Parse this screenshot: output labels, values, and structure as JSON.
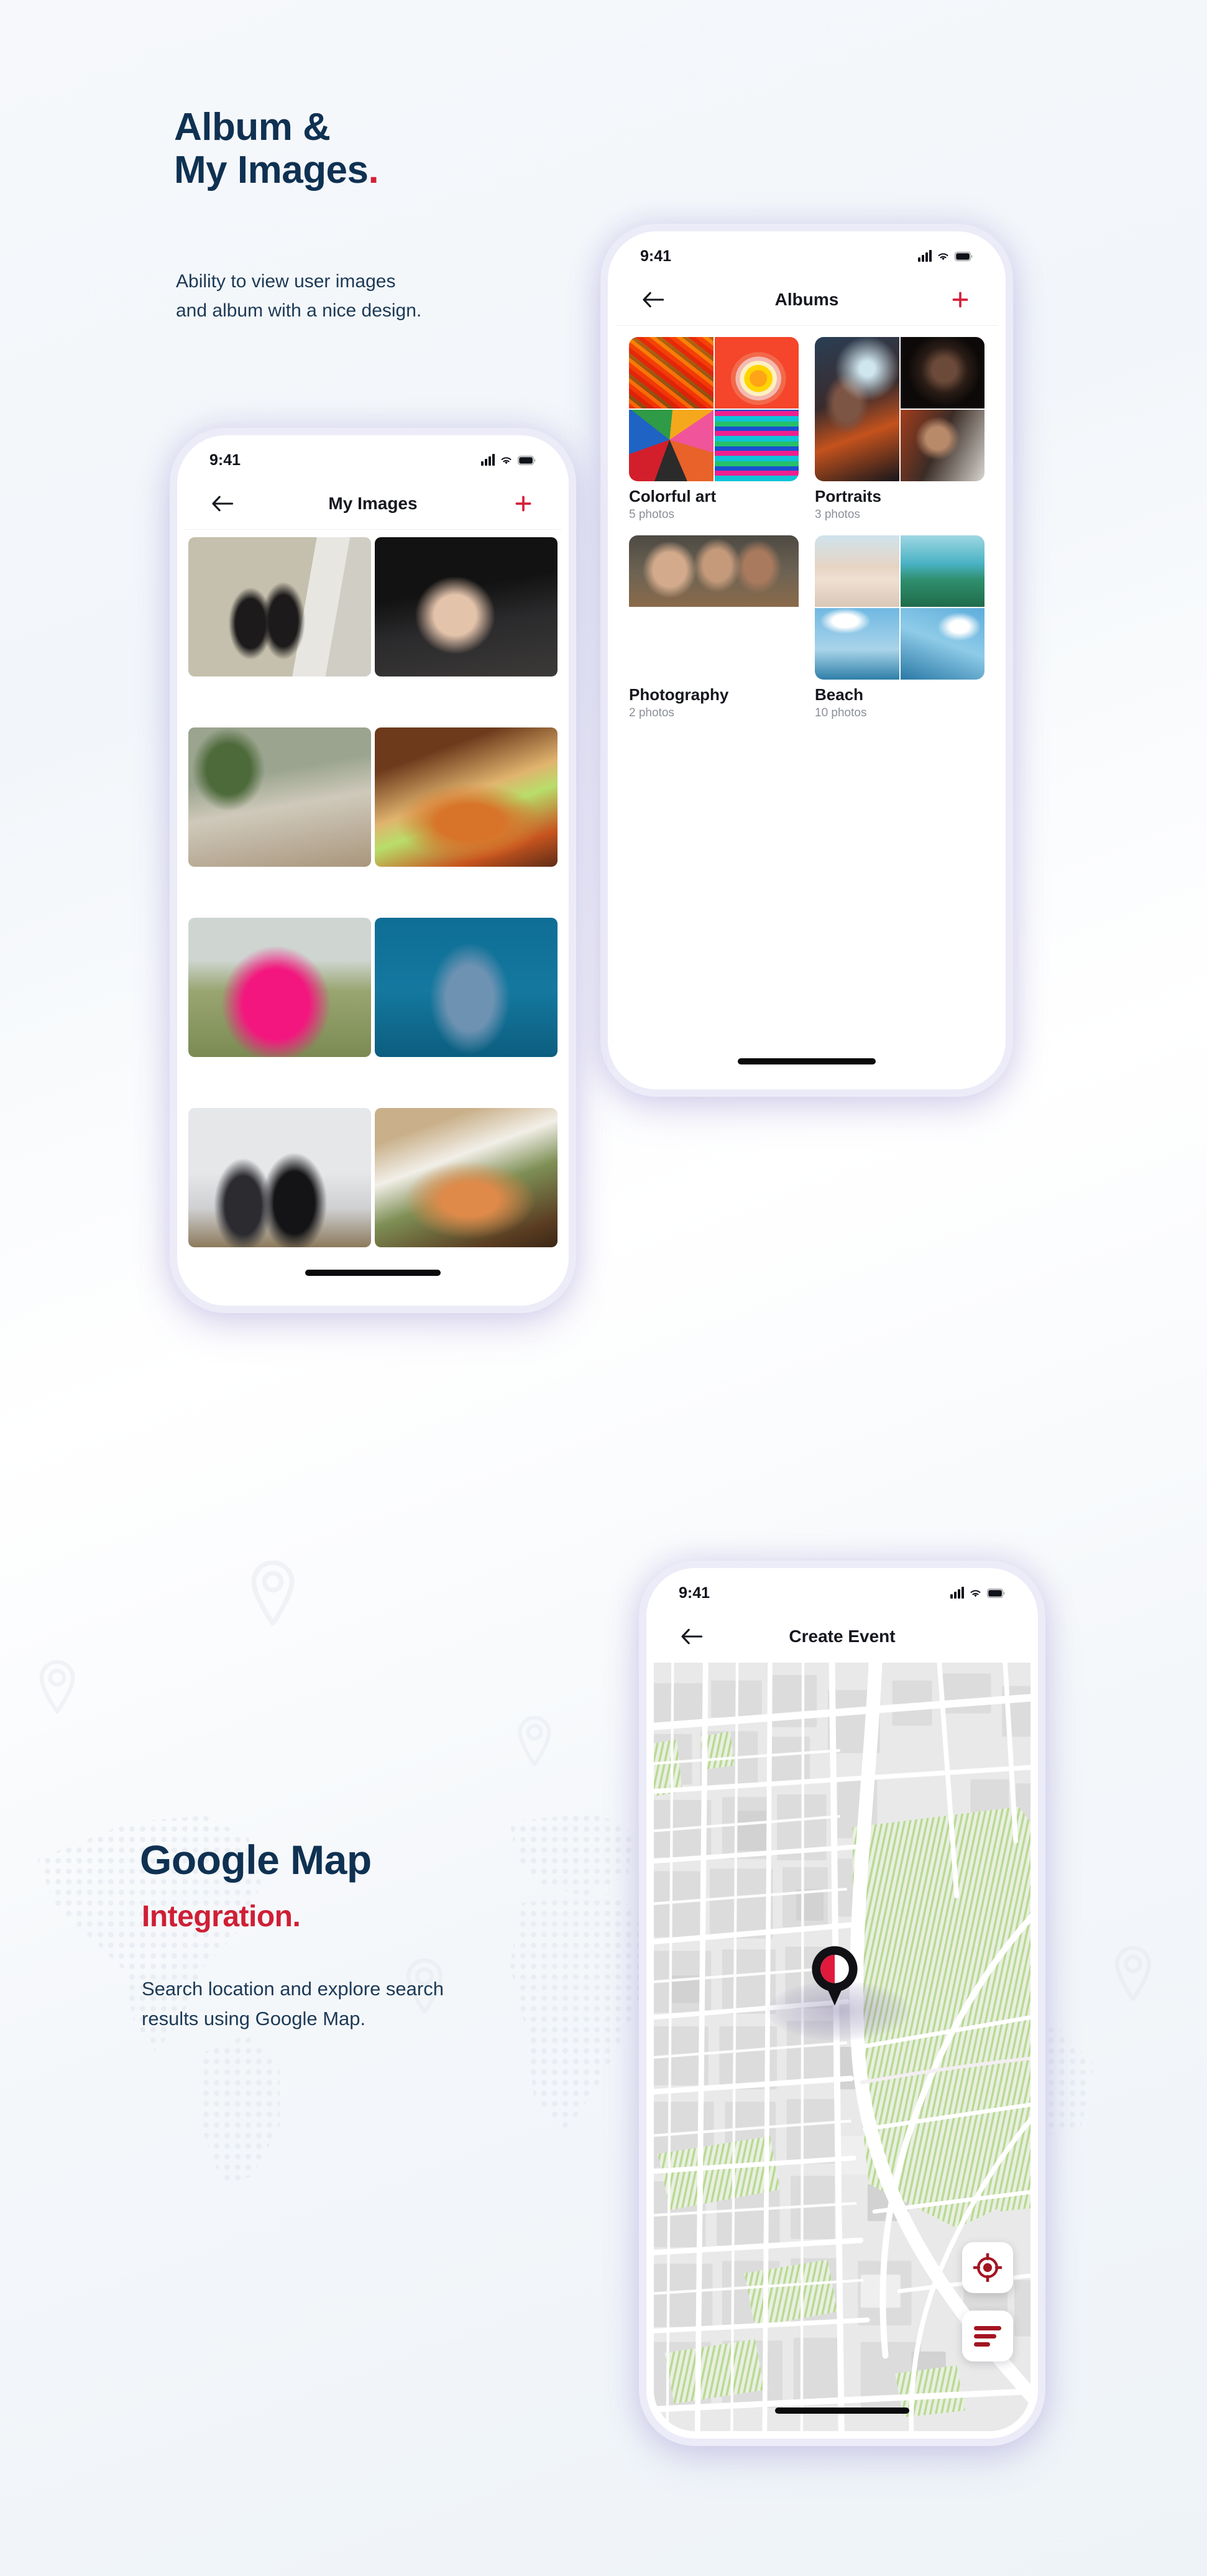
{
  "section1": {
    "headline_line1": "Album &",
    "headline_line2": "My Images",
    "headline_dot": ".",
    "sub_line1": "Ability to view user images",
    "sub_line2": "and album with a nice design."
  },
  "section2": {
    "headline": "Google Map",
    "headline_sub": "Integration",
    "headline_dot": ".",
    "sub_line1": "Search location and explore search",
    "sub_line2": "results using Google Map."
  },
  "colors": {
    "navy": "#0f3152",
    "red": "#d32038",
    "accent_dark_red": "#a31521",
    "bezel": "#ecebf8",
    "page_bg": "#f4f7fa"
  },
  "phone_my_images": {
    "status": {
      "time": "9:41",
      "signal_icon": "cellular-bars-icon",
      "wifi_icon": "wifi-icon",
      "battery_icon": "battery-full-icon"
    },
    "nav": {
      "back_icon": "arrow-left-icon",
      "title": "My Images",
      "add_icon": "plus-icon"
    },
    "photos": [
      {
        "name": "two-people-at-laptop",
        "tone": "#b9b5a3"
      },
      {
        "name": "hands-over-laptop-dark",
        "tone": "#241f1c"
      },
      {
        "name": "desk-with-plants-imac",
        "tone": "#7e8677"
      },
      {
        "name": "tacos-close-up",
        "tone": "#b0661f"
      },
      {
        "name": "two-women-in-pink-race-shirts",
        "tone": "#e0187f"
      },
      {
        "name": "person-in-denim-jacket-blue-wall",
        "tone": "#1d6e92"
      },
      {
        "name": "people-in-workshop-room",
        "tone": "#9a9a9d"
      },
      {
        "name": "salmon-dish-on-plate",
        "tone": "#8d6a37"
      }
    ]
  },
  "phone_albums": {
    "status": {
      "time": "9:41",
      "signal_icon": "cellular-bars-icon",
      "wifi_icon": "wifi-icon",
      "battery_icon": "battery-full-icon"
    },
    "nav": {
      "back_icon": "arrow-left-icon",
      "title": "Albums",
      "add_icon": "plus-icon"
    },
    "albums": [
      {
        "name": "Colorful art",
        "count": "5 photos",
        "tiles": [
          "#c8621f",
          "#f0531f",
          "#c8182a",
          "#e91e8c"
        ]
      },
      {
        "name": "Portraits",
        "count": "3 photos",
        "tiles": [
          "#1b1512",
          "#2a3b52",
          "#8a3b20",
          "#141418"
        ]
      },
      {
        "name": "Photography",
        "count": "2 photos",
        "tiles": [
          "#5e5348",
          "#5e5348",
          "#b9c4cf",
          "#b9c4cf"
        ]
      },
      {
        "name": "Beach",
        "count": "10 photos",
        "tiles": [
          "#e7cdbb",
          "#2f8f86",
          "#78b9d9",
          "#3f9fd2"
        ]
      }
    ]
  },
  "phone_map": {
    "status": {
      "time": "9:41",
      "signal_icon": "cellular-bars-icon",
      "wifi_icon": "wifi-icon",
      "battery_icon": "battery-full-icon"
    },
    "nav": {
      "back_icon": "arrow-left-icon",
      "title": "Create Event"
    },
    "marker_icon": "map-pin-marker-icon",
    "fab_locate_icon": "crosshair-target-icon",
    "fab_list_icon": "list-lines-icon"
  }
}
